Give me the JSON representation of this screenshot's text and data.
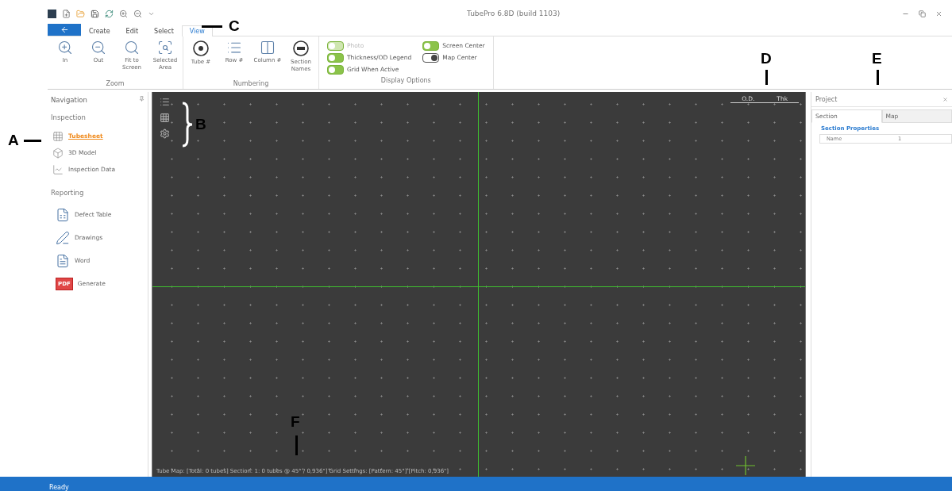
{
  "window": {
    "title": "TubePro 6.8D (build 1103)"
  },
  "menu_tabs": [
    {
      "label": "Create",
      "selected": false
    },
    {
      "label": "Edit",
      "selected": false
    },
    {
      "label": "Select",
      "selected": false
    },
    {
      "label": "View",
      "selected": true
    }
  ],
  "ribbon": {
    "groups": [
      {
        "kind": "buttons",
        "title": "Zoom",
        "buttons": [
          "In",
          "Out",
          "Fit to Screen",
          "Selected Area"
        ]
      },
      {
        "kind": "buttons",
        "title": "Numbering",
        "buttons": [
          "Tube #",
          "Row #",
          "Column #",
          "Section Names"
        ]
      },
      {
        "kind": "toggles",
        "title": "Display Options",
        "toggles": [
          {
            "label": "Photo",
            "on": true,
            "disabled": true
          },
          {
            "label": "Thickness/OD Legend",
            "on": true,
            "disabled": false
          },
          {
            "label": "Grid When Active",
            "on": true,
            "disabled": false
          },
          {
            "label": "Screen Center",
            "on": true,
            "disabled": false
          },
          {
            "label": "Map Center",
            "on": false,
            "disabled": false
          }
        ]
      }
    ]
  },
  "navigation": {
    "title": "Navigation",
    "sections": [
      {
        "title": "Inspection",
        "items": [
          {
            "label": "Tubesheet",
            "selected": true
          },
          {
            "label": "3D Model",
            "selected": false
          },
          {
            "label": "Inspection Data",
            "selected": false
          }
        ]
      },
      {
        "title": "Reporting",
        "items": [
          {
            "label": "Defect Table",
            "selected": false
          },
          {
            "label": "Drawings",
            "selected": false
          },
          {
            "label": "Word",
            "selected": false
          },
          {
            "label": "Generate",
            "selected": false,
            "icon_label": "PDF"
          }
        ]
      }
    ]
  },
  "canvas": {
    "legend_tabs": [
      "O.D.",
      "Thk"
    ],
    "status": "Tube Map: [Total: 0 tubes] Section: 1: 0 tubes @ 45° / 0,936\"] Grid Settings: [Pattern: 45°] [Pitch: 0,936\"]"
  },
  "project_panel": {
    "title": "Project",
    "tabs": [
      {
        "label": "Section",
        "selected": true
      },
      {
        "label": "Map",
        "selected": false
      }
    ],
    "group": "Section Properties",
    "properties": [
      {
        "name": "Name",
        "value": "1"
      }
    ]
  },
  "status_bar": {
    "text": "Ready"
  },
  "annotations": [
    {
      "label": "A"
    },
    {
      "label": "B"
    },
    {
      "label": "C"
    },
    {
      "label": "D"
    },
    {
      "label": "E"
    },
    {
      "label": "F"
    }
  ]
}
